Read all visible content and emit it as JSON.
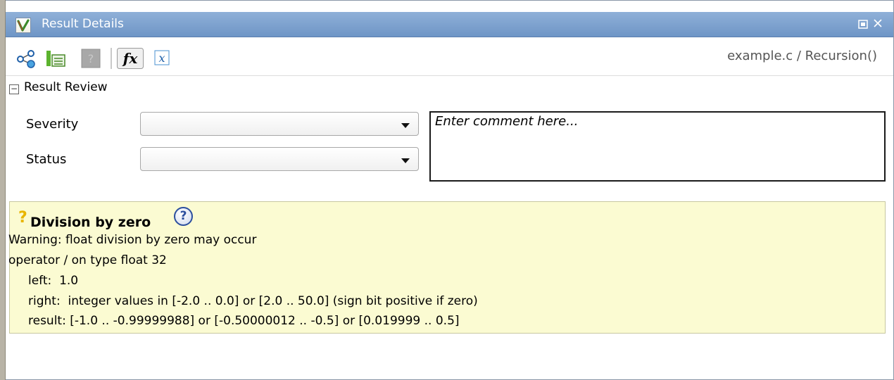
{
  "window": {
    "title": "Result Details"
  },
  "toolbar": {
    "buttons": [
      {
        "icon": "call-graph-icon"
      },
      {
        "icon": "variable-access-icon"
      },
      {
        "icon": "help-disabled-icon"
      },
      {
        "icon": "fx-icon"
      },
      {
        "icon": "x-variable-icon"
      }
    ],
    "breadcrumb": "example.c / Recursion()"
  },
  "review": {
    "section_title": "Result Review",
    "severity_label": "Severity",
    "severity_value": "",
    "status_label": "Status",
    "status_value": "",
    "comment_placeholder": "Enter comment here..."
  },
  "result": {
    "marker": "?",
    "title": "Division by zero",
    "help": "?",
    "lines": [
      "Warning: float division by zero may occur",
      "operator / on type float 32",
      "left:  1.0",
      "right:  integer values in [-2.0 .. 0.0] or [2.0 .. 50.0] (sign bit positive if zero)",
      "result: [-1.0 .. -0.99999988] or [-0.50000012 .. -0.5] or [0.019999 .. 0.5]"
    ]
  },
  "colors": {
    "titlebar": "#7a9fcf",
    "result_background": "#fbfbd2",
    "warning_marker": "#e8b500",
    "help_blue": "#2c4f9e"
  }
}
